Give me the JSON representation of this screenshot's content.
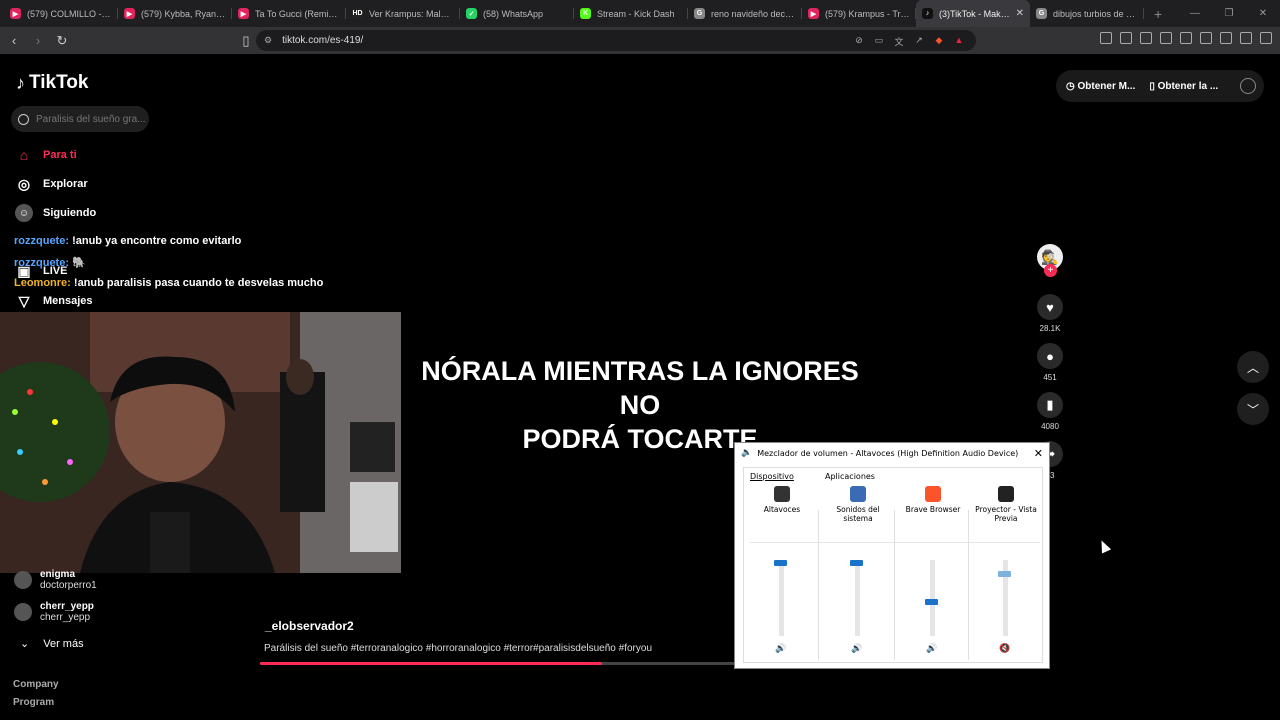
{
  "browser": {
    "tabs": [
      {
        "title": "(579) COLMILLO - Taim",
        "color": "#e0245e",
        "badge": "▶"
      },
      {
        "title": "(579) Kybba, Ryan Cast",
        "color": "#e0245e",
        "badge": "▶"
      },
      {
        "title": "Ta To Gucci (Remix) - G",
        "color": "#e0245e",
        "badge": "▶"
      },
      {
        "title": "Ver Krampus: Maldita N",
        "color": "#222",
        "badge": "HD"
      },
      {
        "title": "(58) WhatsApp",
        "color": "#25d366",
        "badge": "✓"
      },
      {
        "title": "Stream - Kick Dash",
        "color": "#53fc18",
        "badge": "K"
      },
      {
        "title": "reno navideño decorac",
        "color": "#888",
        "badge": "G"
      },
      {
        "title": "(579) Krampus - Tráile",
        "color": "#e0245e",
        "badge": "▶"
      },
      {
        "title": "(3)TikTok - Make Y",
        "color": "#111",
        "badge": "♪",
        "active": true
      },
      {
        "title": "dibujos turbios de niñ",
        "color": "#888",
        "badge": "G"
      }
    ],
    "url": "tiktok.com/es-419/"
  },
  "tiktok": {
    "logo": "TikTok",
    "search_placeholder": "Paralisis del sueño gra...",
    "nav": {
      "for_you": "Para ti",
      "explore": "Explorar",
      "following": "Siguiendo",
      "live": "LIVE",
      "messages": "Mensajes"
    },
    "chat": [
      {
        "user": "rozzquete:",
        "message": "!anub ya encontre como evitarlo"
      },
      {
        "user": "rozzquete:",
        "message": "🐘"
      },
      {
        "user": "Leomonre:",
        "message": "!anub paralisis pasa cuando te desvelas mucho"
      }
    ],
    "accounts": [
      {
        "name": "enigma",
        "handle": "doctorperro1"
      },
      {
        "name": "cherr_yepp",
        "handle": "cherr_yepp"
      }
    ],
    "see_more": "Ver más",
    "footer": [
      "Company",
      "Program"
    ],
    "caption_line1": "NÓRALA MIENTRAS LA IGNORES NO",
    "caption_line2": "PODRÁ TOCARTE",
    "author": "_elobservador2",
    "description": "Parálisis del sueño #terroranalogico #horroranalogico #terror#paralisisdelsueño #foryou",
    "progress": 0.72,
    "stats": {
      "likes": "28.1K",
      "comments": "451",
      "saves": "4080",
      "shares": "63"
    },
    "topright": {
      "get_app": "Obtener M...",
      "get_app2": "Obtener la ..."
    }
  },
  "mixer": {
    "title": "Mezclador de volumen - Altavoces (High Definition Audio Device)",
    "device_header": "Dispositivo",
    "apps_header": "Aplicaciones",
    "channels": [
      {
        "label": "Altavoces",
        "level": 1.0,
        "muted": false,
        "color": "#333"
      },
      {
        "label": "Sonidos del sistema",
        "level": 1.0,
        "muted": false,
        "color": "#3b6bb5"
      },
      {
        "label": "Brave Browser",
        "level": 0.45,
        "muted": false,
        "color": "#fb542b"
      },
      {
        "label": "Proyector - Vista Previa",
        "level": 0.85,
        "muted": true,
        "color": "#222"
      }
    ]
  }
}
